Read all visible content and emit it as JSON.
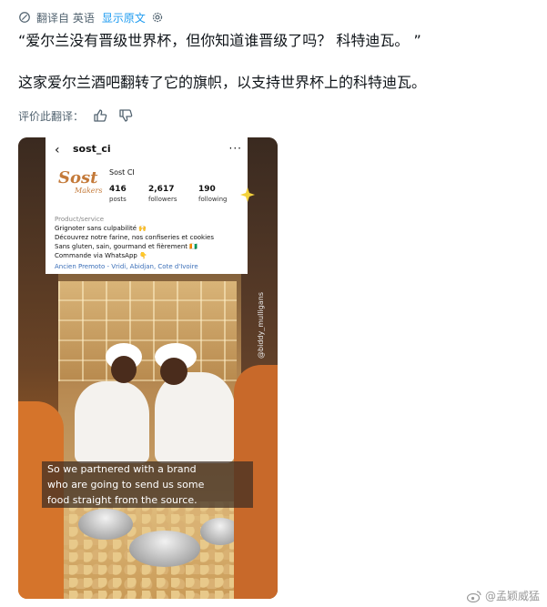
{
  "translate_bar": {
    "label": "翻译自 英语",
    "show_original": "显示原文"
  },
  "tweet": {
    "line1": "“爱尔兰没有晋级世界杯，但你知道谁晋级了吗？ 科特迪瓦。 ”",
    "line2": "这家爱尔兰酒吧翻转了它的旗帜，以支持世界杯上的科特迪瓦。"
  },
  "rate": {
    "label": "评价此翻译："
  },
  "instagram": {
    "handle": "sost_ci",
    "more": "···",
    "back": "‹",
    "logo_text": "Sost",
    "logo_sub": "Makers",
    "name": "Sost CI",
    "stats": [
      {
        "value": "416",
        "label": "posts"
      },
      {
        "value": "2,617",
        "label": "followers"
      },
      {
        "value": "190",
        "label": "following"
      }
    ],
    "category": "Product/service",
    "bio": [
      "Grignoter sans culpabilité 🙌",
      "Découvrez notre farine, nos confiseries et cookies",
      "Sans gluten, sain, gourmand et fièrement 🇨🇮",
      "Commande via WhatsApp 👇"
    ],
    "location": "Ancien Premoto - Vridi, Abidjan, Cote d'Ivoire"
  },
  "video": {
    "side_handle": "@biddy_mulligans",
    "caption_lines": [
      "So we partnered with a brand",
      "who are going to send us some",
      "food straight from the source."
    ]
  },
  "watermark": {
    "text": "@孟颖威猛"
  },
  "colors": {
    "link": "#1d9bf0",
    "muted": "#536471"
  }
}
